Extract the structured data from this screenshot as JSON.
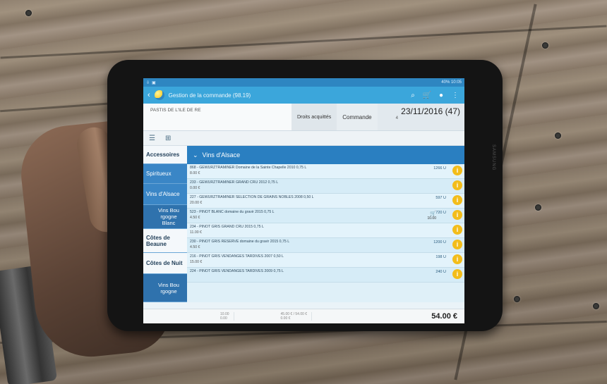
{
  "statusbar": {
    "right": "40% 10:05"
  },
  "appbar": {
    "title": "Gestion de la commande (98.19)"
  },
  "header": {
    "client": "PASTIS DE L'ILE DE RE",
    "tab_droits": "Droits acquittés",
    "tab_commande": "Commande",
    "date": "23/11/2016 (47)",
    "order_no": "4"
  },
  "categories": [
    {
      "label": "Accessoires"
    },
    {
      "label": "Spiritueux"
    },
    {
      "label": "Vins d'Alsace"
    },
    {
      "label": "Vins Bou rgogne Blanc"
    },
    {
      "label": "Côtes de Beaune"
    },
    {
      "label": "Côtes de Nuit"
    },
    {
      "label": "Vins Bou rgogne"
    }
  ],
  "list_header": "Vins d'Alsace",
  "rows": [
    {
      "name": "868 - GEWURZTRAMINER Domaine de la Sainte Chapelle 2010 0,75 L",
      "price": "8.00 €",
      "qty": "1266 U"
    },
    {
      "name": "233 - GEWURZTRAMINER GRAND CRU 2012 0,75 L",
      "price": "0.00 €",
      "qty": ""
    },
    {
      "name": "227 - GEWURZTRAMINER SELECTION DE GRAINS NOBLES 2008 0,50 L",
      "price": "20.00 €",
      "qty": "597 U"
    },
    {
      "name": "523 - PINOT BLANC domaine du gravir 2015 0,75 L",
      "price": "4.50 €",
      "qty": "720 U",
      "cart_qty": "10.00"
    },
    {
      "name": "234 - PINOT GRIS GRAND CRU 2015 0,75 L",
      "price": "11.00 €",
      "qty": ""
    },
    {
      "name": "230 - PINOT GRIS RESERVE domaine du gravir 2015 0,75 L",
      "price": "4.50 €",
      "qty": "1200 U"
    },
    {
      "name": "216 - PINOT GRIS VENDANGES TARDIVES 2007 0,50 L",
      "price": "15.00 €",
      "qty": "198 U"
    },
    {
      "name": "224 - PINOT GRIS VENDANGES TARDIVES 2009 0,75 L",
      "price": "",
      "qty": "240 U"
    }
  ],
  "footer": {
    "qty_a": "10.00",
    "qty_b": "0.00",
    "ht": "45.00 € / 54.00 €",
    "remise": "0.00 €",
    "total": "54.00 €"
  }
}
